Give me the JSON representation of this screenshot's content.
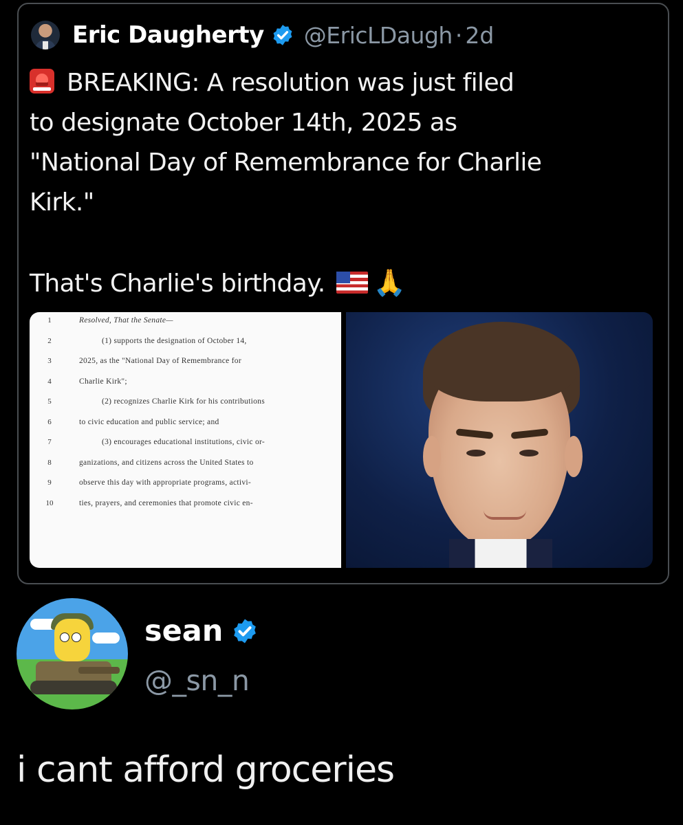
{
  "quoted_tweet": {
    "author_name": "Eric Daugherty",
    "handle": "@EricLDaugh",
    "separator": "·",
    "time": "2d",
    "text_lines": [
      "BREAKING: A resolution was just filed",
      "to designate October 14th, 2025 as",
      "\"National Day of Remembrance for Charlie",
      "Kirk.\"",
      "",
      "That's Charlie's birthday."
    ],
    "icons": [
      "police-light-icon",
      "us-flag-icon",
      "praying-hands-icon",
      "verified-badge-icon"
    ],
    "document_image": {
      "lines": [
        {
          "num": "1",
          "text": "Resolved, That the Senate—"
        },
        {
          "num": "2",
          "text": "(1) supports the designation of October 14,"
        },
        {
          "num": "3",
          "text": "2025, as the \"National Day of Remembrance for"
        },
        {
          "num": "4",
          "text": "Charlie Kirk\";"
        },
        {
          "num": "5",
          "text": "(2) recognizes Charlie Kirk for his contributions"
        },
        {
          "num": "6",
          "text": "to civic education and public service; and"
        },
        {
          "num": "7",
          "text": "(3) encourages educational institutions, civic or-"
        },
        {
          "num": "8",
          "text": "ganizations, and citizens across the United States to"
        },
        {
          "num": "9",
          "text": "observe this day with appropriate programs, activi-"
        },
        {
          "num": "10",
          "text": "ties, prayers, and ceremonies that promote civic en-"
        }
      ]
    }
  },
  "reply": {
    "name": "sean",
    "handle": "@_sn_n",
    "text": "i cant afford groceries"
  },
  "colors": {
    "background": "#000000",
    "verified_blue": "#1d9bf0",
    "secondary_text": "#8b98a5",
    "card_border": "#4a4e52"
  }
}
